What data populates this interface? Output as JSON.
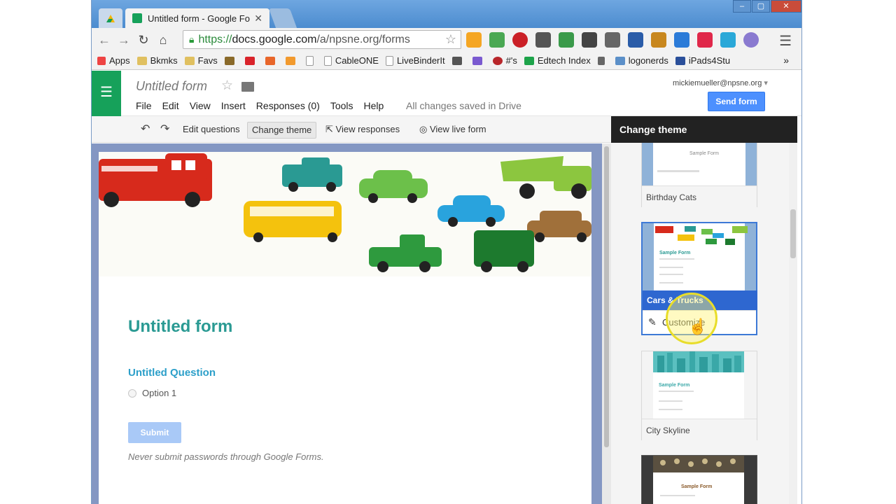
{
  "browser": {
    "tab_title": "Untitled form - Google Fo",
    "url_https": "https://",
    "url_host": "docs.google.com",
    "url_path": "/a/npsne.org/forms"
  },
  "bookmarks": {
    "items": [
      "Apps",
      "Bkmks",
      "Favs",
      "CableONE",
      "LiveBinderIt",
      "#'s",
      "Edtech Index",
      "logonerds",
      "iPads4Stu"
    ],
    "more": "»"
  },
  "forms_header": {
    "doc_title": "Untitled form",
    "menus": [
      "File",
      "Edit",
      "View",
      "Insert",
      "Responses (0)",
      "Tools",
      "Help"
    ],
    "saved_status": "All changes saved in Drive",
    "account": "mickiemueller@npsne.org",
    "send_button": "Send form"
  },
  "form_toolbar": {
    "edit_questions": "Edit questions",
    "change_theme": "Change theme",
    "view_responses": "View responses",
    "view_live_form": "View live form"
  },
  "form": {
    "title": "Untitled form",
    "question": "Untitled Question",
    "option": "Option 1",
    "submit": "Submit",
    "warning": "Never submit passwords through Google Forms."
  },
  "theme_panel": {
    "title": "Change theme",
    "themes": [
      {
        "name": "Birthday Cats"
      },
      {
        "name": "Cars & Trucks",
        "selected": true,
        "action": "Customize"
      },
      {
        "name": "City Skyline"
      }
    ],
    "sample_form_label": "Sample Form"
  },
  "colors": {
    "forms_green": "#16a15a",
    "send_blue": "#4d90fe",
    "title_teal": "#2a9a93",
    "question_blue": "#2c9fc9",
    "selected_theme": "#2e67d0"
  }
}
